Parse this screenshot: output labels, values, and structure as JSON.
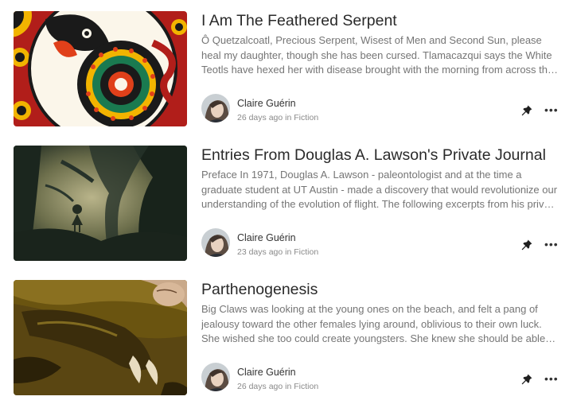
{
  "posts": [
    {
      "title": "I Am The Feathered Serpent",
      "excerpt": "Ô Quetzalcoatl, Precious Serpent, Wisest of Men and Second Sun, please heal my daughter, though she has been cursed. Tlamacazqui says the White Teotls have hexed her with disease brought with the morning from across the vast ocean, and…",
      "author": "Claire Guérin",
      "time": "26 days ago",
      "in": "in",
      "category": "Fiction",
      "image": "feathered-serpent-illustration"
    },
    {
      "title": "Entries From Douglas A. Lawson's Private Journal",
      "excerpt": "Preface In 1971, Douglas A. Lawson - paleontologist and at the time a graduate student at UT Austin - made a discovery that would revolutionize our understanding of the evolution of flight. The following excerpts from his private journal have surviv…",
      "author": "Claire Guérin",
      "time": "23 days ago",
      "in": "in",
      "category": "Fiction",
      "image": "forest-girl-illustration"
    },
    {
      "title": "Parthenogenesis",
      "excerpt": "Big Claws was looking at the young ones on the beach, and felt a pang of jealousy toward the other females lying around, oblivious to their own luck. She wished she too could create youngsters. She knew she should be able to, but that power…",
      "author": "Claire Guérin",
      "time": "26 days ago",
      "in": "in",
      "category": "Fiction",
      "image": "reptile-claw-illustration"
    }
  ],
  "icons": {
    "pin": "pushpin-icon",
    "more": "more-options-icon"
  },
  "more_glyph": "•••"
}
